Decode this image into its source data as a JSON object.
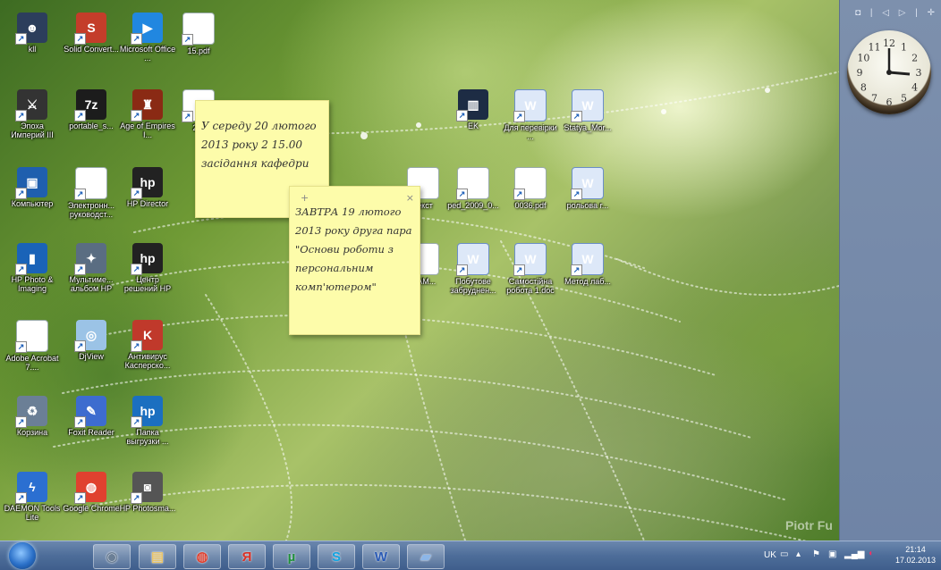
{
  "desktop": {
    "icons": [
      {
        "label": "kll",
        "icon": "user-icon",
        "color": "#2c3e5c"
      },
      {
        "label": "Solid Convert...",
        "icon": "solid-converter-icon",
        "color": "#c43d2a"
      },
      {
        "label": "Microsoft Office ...",
        "icon": "play-icon",
        "color": "#2187e0"
      },
      {
        "label": "15.pdf",
        "icon": "pdf-doc-icon",
        "color": "#ffffff"
      },
      {
        "label": "Эпоха Империй III",
        "icon": "game-icon",
        "color": "#333333"
      },
      {
        "label": "portable_s...",
        "icon": "7zip-icon",
        "color": "#1c1c1c"
      },
      {
        "label": "Age of Empires I...",
        "icon": "helmet-icon",
        "color": "#8a2a14"
      },
      {
        "label": "28(",
        "icon": "doc-icon",
        "color": "#ffffff"
      },
      {
        "label": "Компьютер",
        "icon": "computer-icon",
        "color": "#1f5fae"
      },
      {
        "label": "Электронн... руководст...",
        "icon": "doc-icon",
        "color": "#ffffff"
      },
      {
        "label": "HP Director",
        "icon": "hp-icon",
        "color": "#222222"
      },
      {
        "label": "HP Photo & Imaging",
        "icon": "hp-photo-icon",
        "color": "#1a63b8"
      },
      {
        "label": "Мультиме... альбом HP",
        "icon": "album-icon",
        "color": "#5a6d82"
      },
      {
        "label": "Центр решений HP",
        "icon": "hp-icon",
        "color": "#222222"
      },
      {
        "label": "Adobe Acrobat 7....",
        "icon": "acrobat-icon",
        "color": "#ffffff"
      },
      {
        "label": "DjView",
        "icon": "djview-icon",
        "color": "#9bc3e6"
      },
      {
        "label": "Антивирус Касперско...",
        "icon": "kaspersky-icon",
        "color": "#c0392b"
      },
      {
        "label": "Корзина",
        "icon": "recycle-bin-icon",
        "color": "#6b7f96"
      },
      {
        "label": "Foxit Reader",
        "icon": "foxit-icon",
        "color": "#3d6ccf"
      },
      {
        "label": "Папка выгрузки ...",
        "icon": "hp-folder-icon",
        "color": "#1b6fc0"
      },
      {
        "label": "DAEMON Tools Lite",
        "icon": "daemon-tools-icon",
        "color": "#2b6fd1"
      },
      {
        "label": "Google Chrome",
        "icon": "chrome-icon",
        "color": "#e0412f"
      },
      {
        "label": "HP Photosma...",
        "icon": "camera-icon",
        "color": "#555555"
      },
      {
        "label": "EK",
        "icon": "book-icon",
        "color": "#1d2c44"
      },
      {
        "label": "Для перевірки ...",
        "icon": "word-icon",
        "color": "#dde8f8"
      },
      {
        "label": "Statya_Mor...",
        "icon": "word-icon",
        "color": "#dde8f8"
      },
      {
        "label": "текст",
        "icon": "doc-icon",
        "color": "#ffffff"
      },
      {
        "label": "ped_2009_0...",
        "icon": "doc-icon",
        "color": "#ffffff"
      },
      {
        "label": "0036.pdf",
        "icon": "pdf-doc-icon",
        "color": "#ffffff"
      },
      {
        "label": "рольова г...",
        "icon": "word-icon",
        "color": "#dde8f8"
      },
      {
        "label": "...АМ...",
        "icon": "doc-icon",
        "color": "#ffffff"
      },
      {
        "label": "Побутове забруднен...",
        "icon": "word-icon",
        "color": "#dde8f8"
      },
      {
        "label": "Самостійна робота 1.doc",
        "icon": "word-icon",
        "color": "#dde8f8"
      },
      {
        "label": "Метод лаб...",
        "icon": "word-icon",
        "color": "#dde8f8"
      }
    ],
    "watermark": "Piotr Fu"
  },
  "notes": [
    {
      "text": "У середу 20 лютого 2013 року 2 15.00 засідання кафедри"
    },
    {
      "text": "ЗАВТРА 19 лютого 2013 року друга пара \"Основи роботи з персональним комп'ютером\"",
      "add_glyph": "+",
      "close_glyph": "×"
    }
  ],
  "sidebar": {
    "controls": "◘ | ◁ ▷ | ✛",
    "clock_numbers": [
      "12",
      "1",
      "2",
      "3",
      "4",
      "5",
      "6",
      "7",
      "8",
      "9",
      "10",
      "11"
    ]
  },
  "taskbar": {
    "pinned": [
      {
        "name": "media-player-icon",
        "glyph": "◉"
      },
      {
        "name": "explorer-icon",
        "glyph": "▤"
      },
      {
        "name": "chrome-icon",
        "glyph": "◍"
      },
      {
        "name": "yandex-icon",
        "glyph": "Я"
      },
      {
        "name": "utorrent-icon",
        "glyph": "µ"
      },
      {
        "name": "skype-icon",
        "glyph": "S"
      },
      {
        "name": "word-icon",
        "glyph": "W"
      },
      {
        "name": "folder-icon",
        "glyph": "▰"
      }
    ],
    "tray": {
      "language": "UK",
      "time": "21:14",
      "date": "17.02.2013"
    }
  }
}
